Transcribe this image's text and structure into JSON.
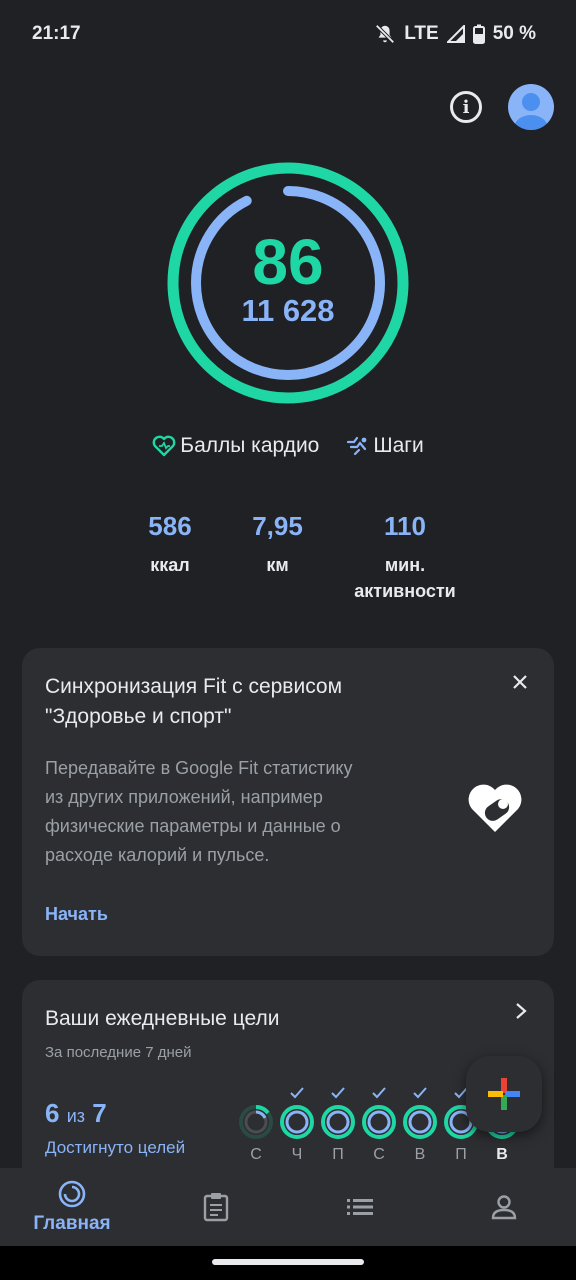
{
  "status_bar": {
    "time": "21:17",
    "network": "LTE",
    "battery": "50 %"
  },
  "rings": {
    "score": "86",
    "steps": "11 628",
    "cardio_color": "#1ed7a5",
    "steps_color": "#8ab4f8"
  },
  "legend": {
    "cardio_label": "Баллы кардио",
    "steps_label": "Шаги"
  },
  "stats": [
    {
      "value": "586",
      "label": "ккал"
    },
    {
      "value": "7,95",
      "label": "км"
    },
    {
      "value": "110",
      "label_line1": "мин.",
      "label_line2": "активности"
    }
  ],
  "sync_card": {
    "title_line1": "Синхронизация Fit с сервисом",
    "title_line2": "\"Здоровье и спорт\"",
    "desc_line1": "Передавайте в Google Fit статистику",
    "desc_line2": "из других приложений, например",
    "desc_line3": "физические параметры и данные о",
    "desc_line4": "расходе калорий и пульсе.",
    "action": "Начать"
  },
  "goals_card": {
    "title": "Ваши ежедневные цели",
    "subtitle": "За последние 7 дней",
    "achieved": "6",
    "of_word": "из",
    "total": "7",
    "achieved_label": "Достигнуто целей",
    "days": [
      "С",
      "Ч",
      "П",
      "С",
      "В",
      "П",
      "В"
    ]
  },
  "nav": {
    "home_label": "Главная"
  }
}
